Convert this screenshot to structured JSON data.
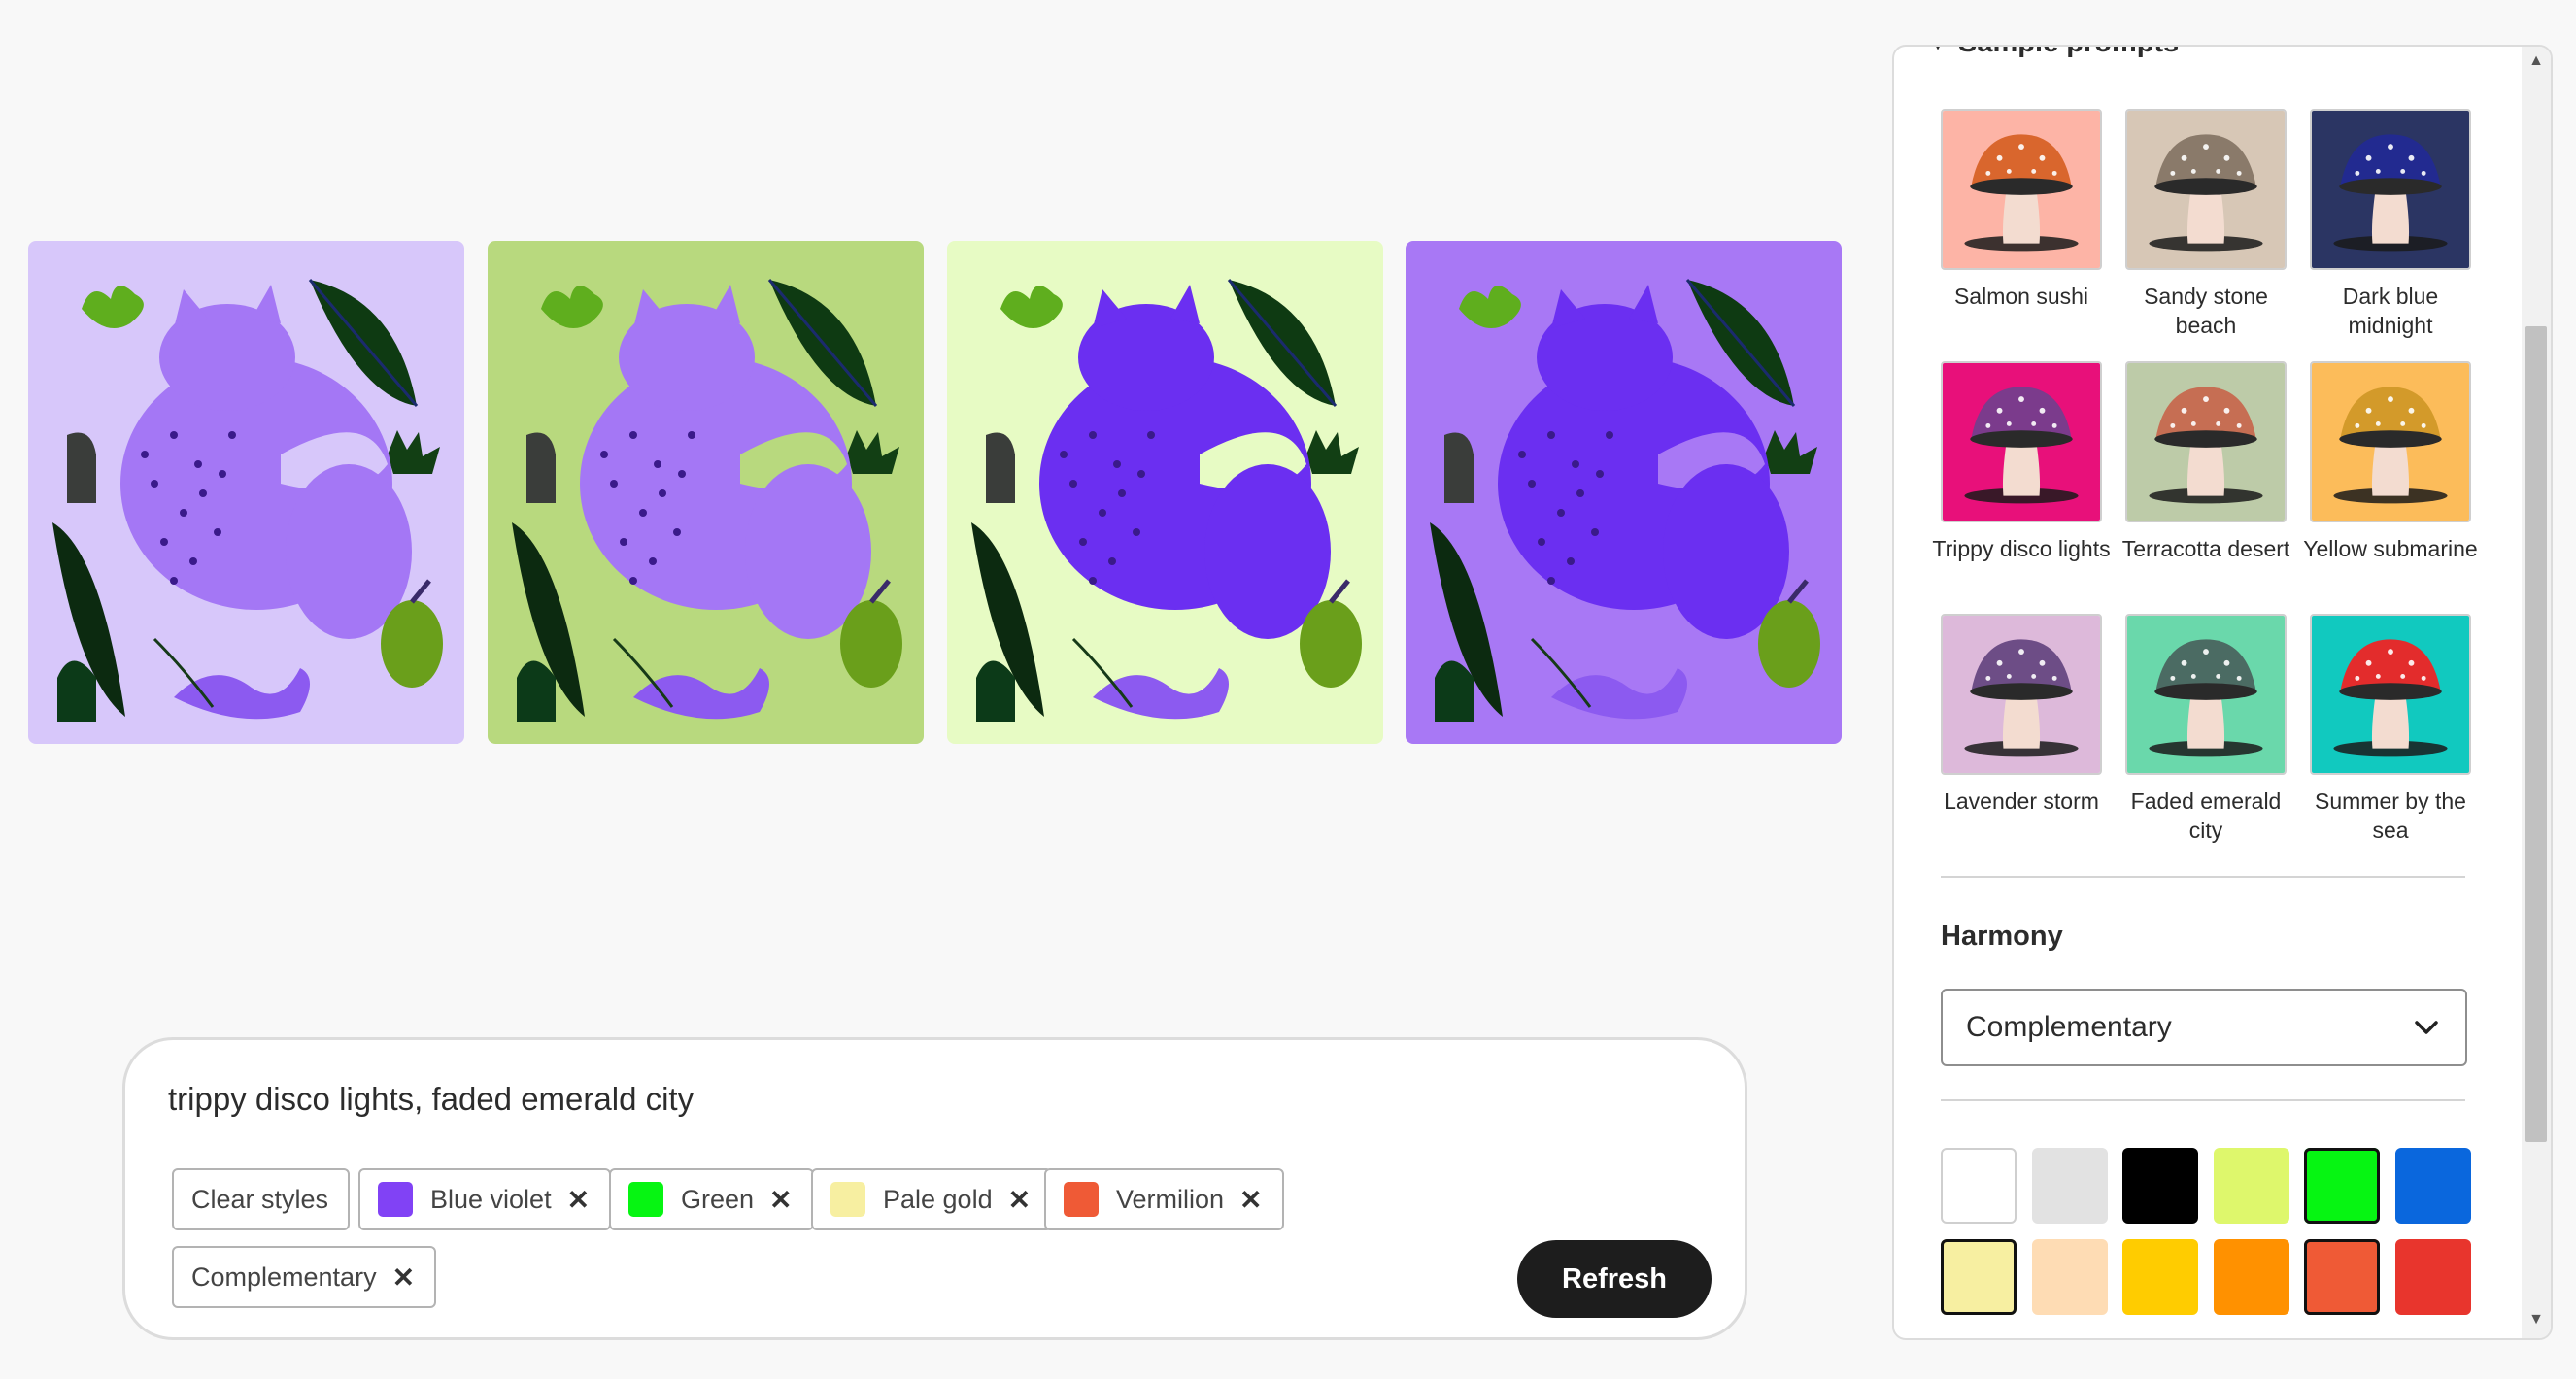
{
  "prompt": {
    "text": "trippy disco lights, faded emerald city",
    "chips": [
      {
        "label": "Clear styles"
      },
      {
        "label": "Blue violet",
        "color": "#8142f5"
      },
      {
        "label": "Green",
        "color": "#06f512"
      },
      {
        "label": "Pale gold",
        "color": "#f7efa1"
      },
      {
        "label": "Vermilion",
        "color": "#ef5a36"
      },
      {
        "label": "Complementary"
      }
    ],
    "refresh_label": "Refresh"
  },
  "previews": [
    {
      "bg": "#d7c7fa",
      "cat": "#a477f5"
    },
    {
      "bg": "#b8d97e",
      "cat": "#a477f5"
    },
    {
      "bg": "#e7fbc4",
      "cat": "#6b2ff1"
    },
    {
      "bg": "#a878f5",
      "cat": "#6b2ff1"
    }
  ],
  "panel": {
    "section_title": "Sample prompts",
    "samples": [
      {
        "label": "Salmon sushi",
        "bg": "#fdb4a6",
        "cap": "#d9662d"
      },
      {
        "label": "Sandy stone beach",
        "bg": "#d7c7b6",
        "cap": "#8a7a6a"
      },
      {
        "label": "Dark blue midnight",
        "bg": "#2b3563",
        "cap": "#222a90"
      },
      {
        "label": "Trippy disco lights",
        "bg": "#e8107a",
        "cap": "#7b3b8c"
      },
      {
        "label": "Terracotta desert",
        "bg": "#bdcba8",
        "cap": "#c66e53"
      },
      {
        "label": "Yellow submarine",
        "bg": "#fcbc5a",
        "cap": "#d39a2a"
      },
      {
        "label": "Lavender storm",
        "bg": "#ddb9da",
        "cap": "#6d4d86"
      },
      {
        "label": "Faded emerald city",
        "bg": "#6ad8ab",
        "cap": "#4b6b63"
      },
      {
        "label": "Summer by the sea",
        "bg": "#11c9bf",
        "cap": "#e32c2c"
      }
    ],
    "harmony_title": "Harmony",
    "harmony_value": "Complementary",
    "swatches": [
      {
        "color": "#ffffff",
        "selected": false
      },
      {
        "color": "#e2e2e2",
        "selected": false
      },
      {
        "color": "#000000",
        "selected": false
      },
      {
        "color": "#def76c",
        "selected": false
      },
      {
        "color": "#06f512",
        "selected": true
      },
      {
        "color": "#0a67dd",
        "selected": false
      },
      {
        "color": "#f7efa1",
        "selected": true
      },
      {
        "color": "#fedcb4",
        "selected": false
      },
      {
        "color": "#ffcc00",
        "selected": false
      },
      {
        "color": "#ff9100",
        "selected": false
      },
      {
        "color": "#ef5a36",
        "selected": true
      },
      {
        "color": "#e8352d",
        "selected": false
      }
    ]
  }
}
